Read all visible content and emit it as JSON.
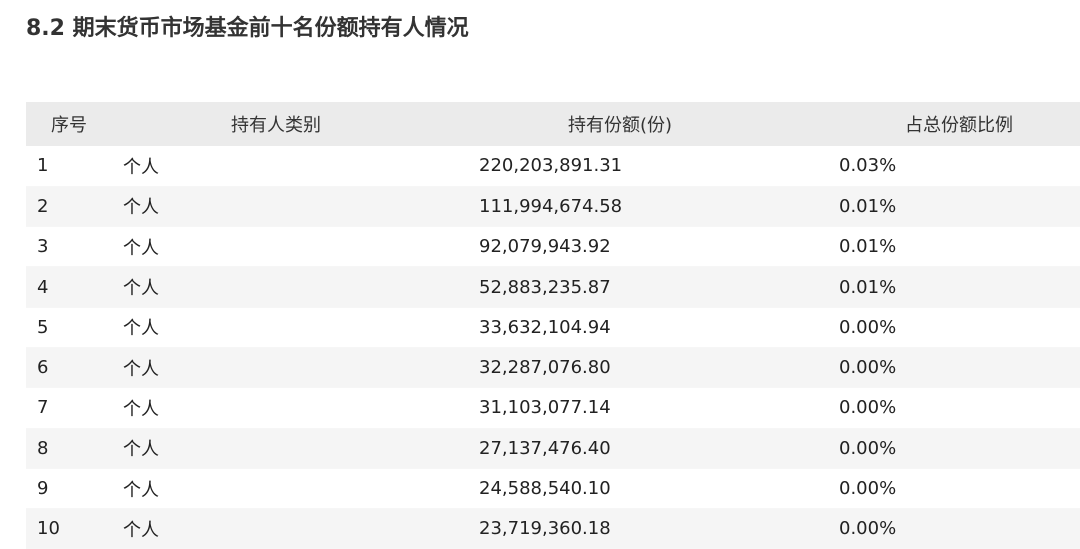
{
  "title": "8.2 期末货币市场基金前十名份额持有人情况",
  "table": {
    "headers": {
      "seq": "序号",
      "holder_type": "持有人类别",
      "shares": "持有份额(份)",
      "ratio": "占总份额比例"
    },
    "rows": [
      {
        "seq": "1",
        "holder_type": "个人",
        "shares": "220,203,891.31",
        "ratio": "0.03%"
      },
      {
        "seq": "2",
        "holder_type": "个人",
        "shares": "111,994,674.58",
        "ratio": "0.01%"
      },
      {
        "seq": "3",
        "holder_type": "个人",
        "shares": "92,079,943.92",
        "ratio": "0.01%"
      },
      {
        "seq": "4",
        "holder_type": "个人",
        "shares": "52,883,235.87",
        "ratio": "0.01%"
      },
      {
        "seq": "5",
        "holder_type": "个人",
        "shares": "33,632,104.94",
        "ratio": "0.00%"
      },
      {
        "seq": "6",
        "holder_type": "个人",
        "shares": "32,287,076.80",
        "ratio": "0.00%"
      },
      {
        "seq": "7",
        "holder_type": "个人",
        "shares": "31,103,077.14",
        "ratio": "0.00%"
      },
      {
        "seq": "8",
        "holder_type": "个人",
        "shares": "27,137,476.40",
        "ratio": "0.00%"
      },
      {
        "seq": "9",
        "holder_type": "个人",
        "shares": "24,588,540.10",
        "ratio": "0.00%"
      },
      {
        "seq": "10",
        "holder_type": "个人",
        "shares": "23,719,360.18",
        "ratio": "0.00%"
      }
    ]
  }
}
